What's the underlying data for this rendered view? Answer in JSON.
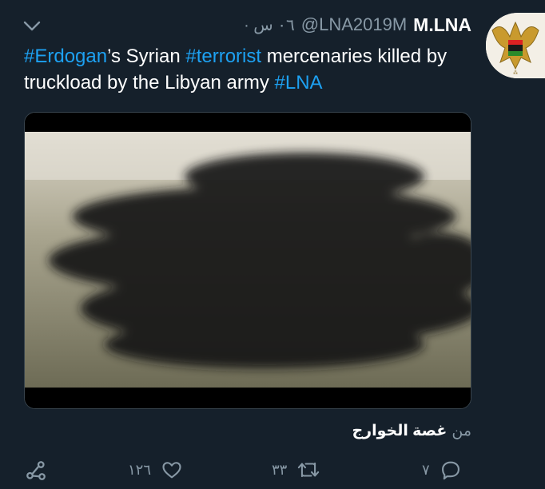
{
  "tweet": {
    "display_name": "M.LNA",
    "handle": "@LNA2019M",
    "time": "٠٦ س ·",
    "text_parts": [
      {
        "text": "#Erdogan",
        "tag": true
      },
      {
        "text": "’s Syrian ",
        "tag": false
      },
      {
        "text": "#terrorist",
        "tag": true
      },
      {
        "text": " mercenaries  killed by truckload by the Libyan army ",
        "tag": false
      },
      {
        "text": "#LNA",
        "tag": true
      }
    ],
    "source_prefix": "من",
    "source_name": "غصة الخوارج"
  },
  "actions": {
    "reply_count": "٧",
    "retweet_count": "٣٣",
    "like_count": "١٢٦"
  },
  "icons": {
    "menu": "chevron-down-icon",
    "avatar": "eagle-emblem",
    "reply": "reply-icon",
    "retweet": "retweet-icon",
    "like": "heart-icon",
    "share": "share-icon"
  },
  "colors": {
    "background": "#15202b",
    "accent": "#1da1f2",
    "muted": "#8899a6"
  }
}
